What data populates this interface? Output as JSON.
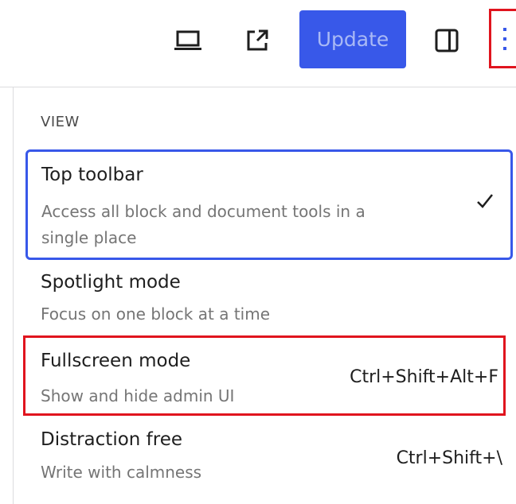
{
  "header": {
    "preview_icon": "laptop-icon",
    "view_post_icon": "external-link-icon",
    "update_label": "Update",
    "settings_icon": "sidebar-panel-icon",
    "options_icon": "more-vertical-icon",
    "accent_color": "#3858e9",
    "highlight_color": "#e0141e"
  },
  "menu": {
    "group_label": "VIEW",
    "items": [
      {
        "title": "Top toolbar",
        "description": "Access all block and document tools in a single place",
        "checked": true,
        "check_icon": "checkmark-icon"
      },
      {
        "title": "Spotlight mode",
        "description": "Focus on one block at a time"
      },
      {
        "title": "Fullscreen mode",
        "description": "Show and hide admin UI",
        "shortcut": "Ctrl+Shift+Alt+F"
      },
      {
        "title": "Distraction free",
        "description": "Write with calmness",
        "shortcut": "Ctrl+Shift+\\"
      }
    ]
  }
}
